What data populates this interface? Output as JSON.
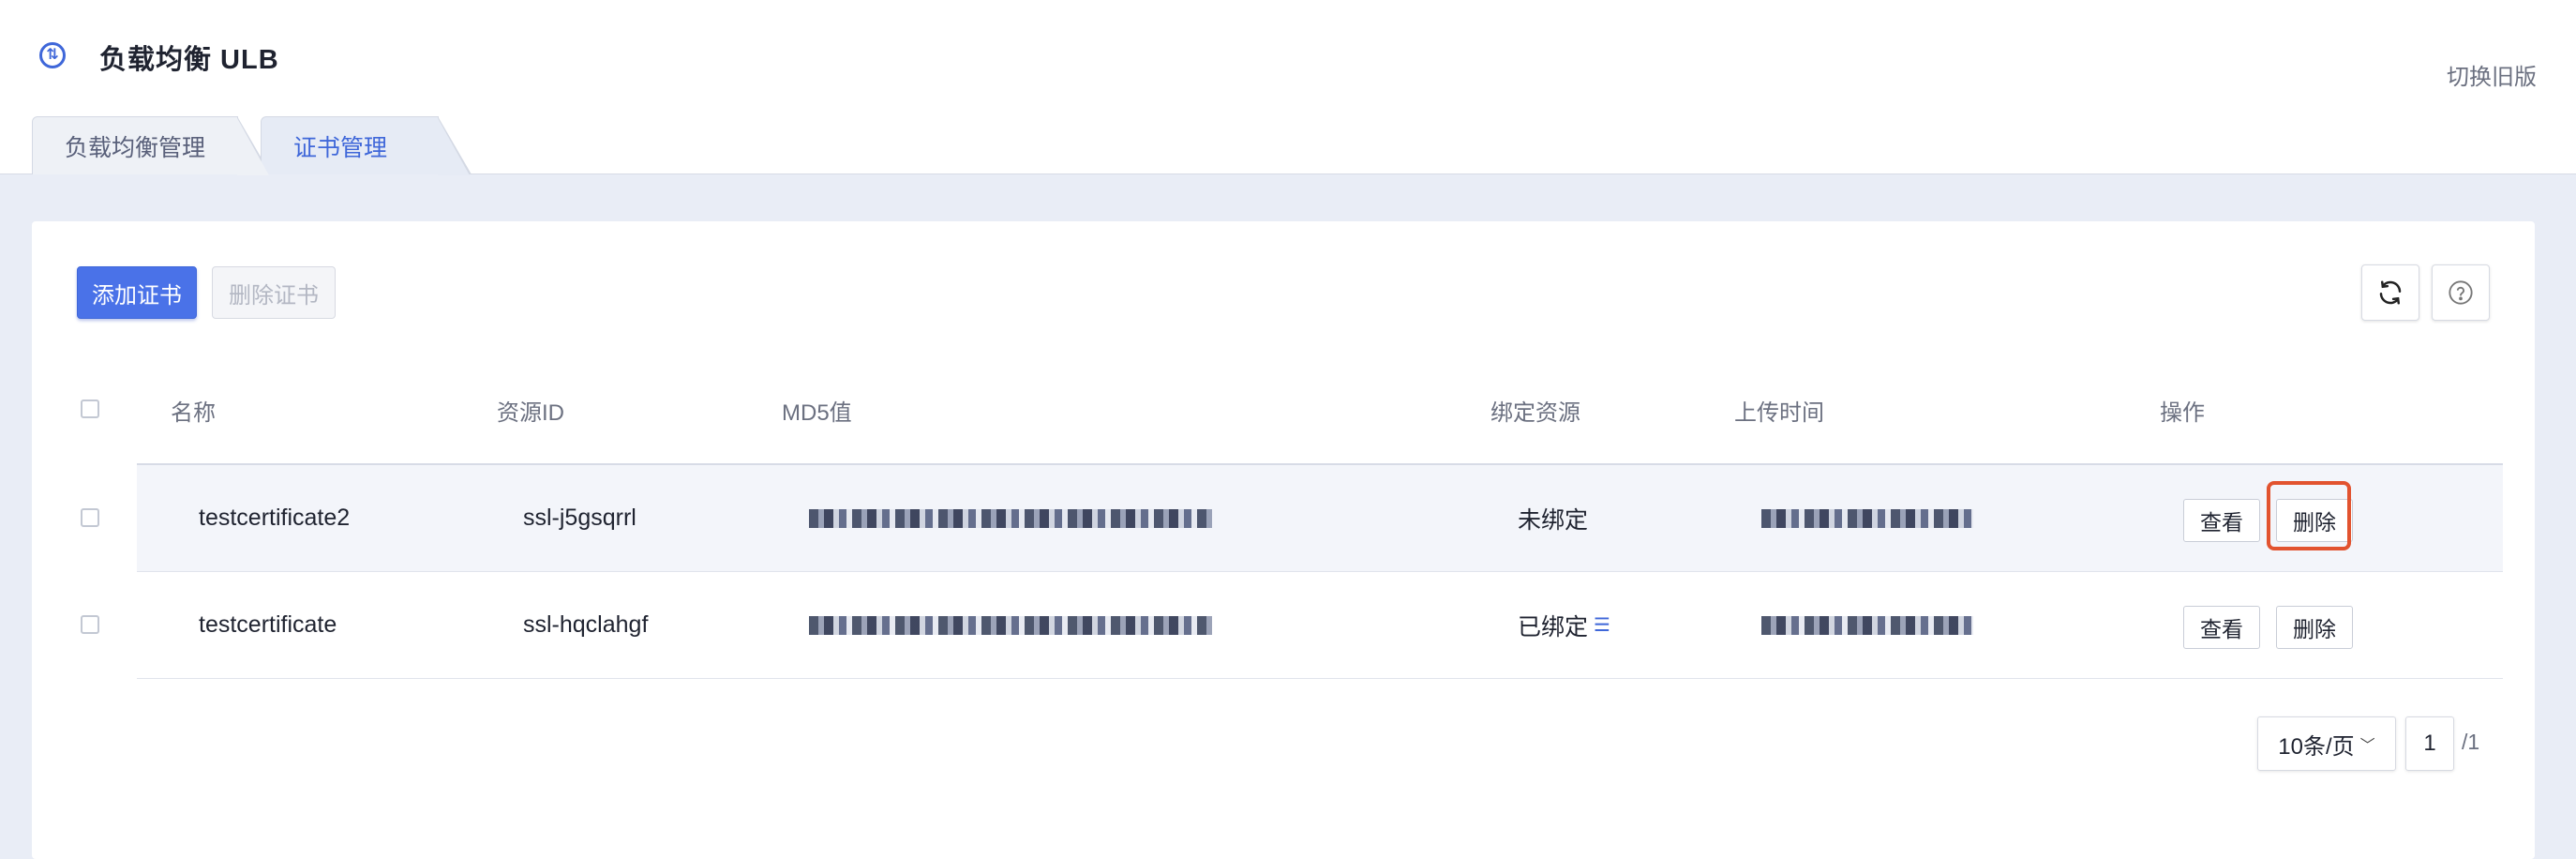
{
  "header": {
    "product_title": "负载均衡 ULB",
    "switch_old_label": "切换旧版"
  },
  "tabs": [
    {
      "label": "负载均衡管理",
      "active": false
    },
    {
      "label": "证书管理",
      "active": true
    }
  ],
  "toolbar": {
    "add_label": "添加证书",
    "delete_label": "删除证书"
  },
  "icons": {
    "product": "load-balancer-icon",
    "refresh": "refresh-icon",
    "help": "help-icon",
    "bound_list": "list-icon"
  },
  "table": {
    "columns": [
      "名称",
      "资源ID",
      "MD5值",
      "绑定资源",
      "上传时间",
      "操作"
    ],
    "rows": [
      {
        "name": "testcertificate2",
        "resource_id": "ssl-j5gsqrrl",
        "bind": "未绑定",
        "view": "查看",
        "delete": "删除"
      },
      {
        "name": "testcertificate",
        "resource_id": "ssl-hqclahgf",
        "bind": "已绑定",
        "view": "查看",
        "delete": "删除"
      }
    ]
  },
  "pagination": {
    "page_size": "10条/页",
    "current_page": "1",
    "total_pages": "/1"
  },
  "colors": {
    "accent": "#4a72e8",
    "highlight": "#e2532f",
    "page_bg": "#e9edf6"
  }
}
